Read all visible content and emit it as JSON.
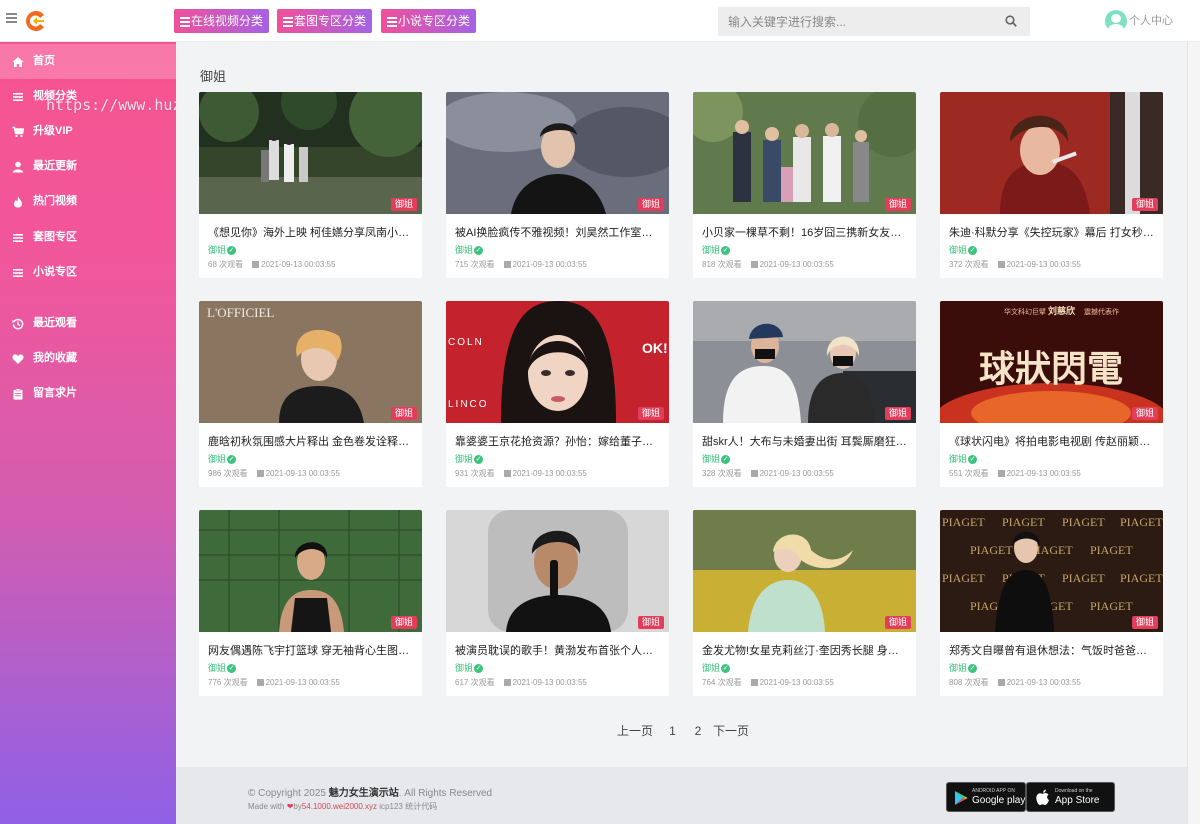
{
  "header": {
    "categories": [
      {
        "label": "在线视频分类"
      },
      {
        "label": "套图专区分类"
      },
      {
        "label": "小说专区分类"
      }
    ],
    "search_placeholder": "输入关键字进行搜索...",
    "user_center_label": "个人中心"
  },
  "sidebar": {
    "items": [
      {
        "label": "首页",
        "icon": "home-icon",
        "active": true
      },
      {
        "label": "视频分类",
        "icon": "list-icon"
      },
      {
        "label": "升级VIP",
        "icon": "cart-icon"
      },
      {
        "label": "最近更新",
        "icon": "user-icon"
      },
      {
        "label": "热门视频",
        "icon": "fire-icon"
      },
      {
        "label": "套图专区",
        "icon": "list-icon"
      },
      {
        "label": "小说专区",
        "icon": "list-icon"
      },
      {
        "label": "最近观看",
        "icon": "history-icon"
      },
      {
        "label": "我的收藏",
        "icon": "heart-icon"
      },
      {
        "label": "留言求片",
        "icon": "clipboard-icon"
      }
    ]
  },
  "watermark": "https://www.huzhan.com/ishop15931",
  "main": {
    "section_title": "御姐",
    "cards": [
      {
        "title": "《想见你》海外上映 柯佳嬿分享凤南小队登…",
        "category": "御姐",
        "badge": "御姐",
        "views": "68 次观看",
        "date": "2021-09-13 00:03:55"
      },
      {
        "title": "被AI换脸疯传不雅视频！刘昊然工作室报警…",
        "category": "御姐",
        "badge": "御姐",
        "views": "715 次观看",
        "date": "2021-09-13 00:03:55"
      },
      {
        "title": "小贝家一棵草不剩！16岁囧三携新女友现身…",
        "category": "御姐",
        "badge": "御姐",
        "views": "818 次观看",
        "date": "2021-09-13 00:03:55"
      },
      {
        "title": "朱迪·科默分享《失控玩家》幕后 打女秒变…",
        "category": "御姐",
        "badge": "御姐",
        "views": "372 次观看",
        "date": "2021-09-13 00:03:55"
      },
      {
        "title": "鹿晗初秋氛围感大片释出 金色卷发诠释双重…",
        "category": "御姐",
        "badge": "御姐",
        "views": "986 次观看",
        "date": "2021-09-13 00:03:55"
      },
      {
        "title": "靠婆婆王京花抢资源？孙怡：嫁给董子健只…",
        "category": "御姐",
        "badge": "御姐",
        "views": "931 次观看",
        "date": "2021-09-13 00:03:55"
      },
      {
        "title": "甜skr人！大布与未婚妻出街 耳鬓厮磨狂秀…",
        "category": "御姐",
        "badge": "御姐",
        "views": "328 次观看",
        "date": "2021-09-13 00:03:55"
      },
      {
        "title": "《球状闪电》将拍电影电视剧 传赵丽颖热巴…",
        "category": "御姐",
        "badge": "御姐",
        "views": "551 次观看",
        "date": "2021-09-13 00:03:55"
      },
      {
        "title": "网友偶遇陈飞宇打篮球 穿无袖背心生图状态…",
        "category": "御姐",
        "badge": "御姐",
        "views": "776 次观看",
        "date": "2021-09-13 00:03:55"
      },
      {
        "title": "被演员耽误的歌手！黄渤发布首张个人音乐…",
        "category": "御姐",
        "badge": "御姐",
        "views": "617 次观看",
        "date": "2021-09-13 00:03:55"
      },
      {
        "title": "金发尤物!女星克莉丝汀·奎因秀长腿 身材高…",
        "category": "御姐",
        "badge": "御姐",
        "views": "764 次观看",
        "date": "2021-09-13 00:03:55"
      },
      {
        "title": "郑秀文自曝曾有退休想法：气饭时爸爸都会…",
        "category": "御姐",
        "badge": "御姐",
        "views": "808 次观看",
        "date": "2021-09-13 00:03:55"
      }
    ],
    "thumb_texts": {
      "magazine": "L'OFFICIEL",
      "colno": "COLN",
      "linco": "LINCO",
      "ok": "OK!",
      "poster_top": "华文科幻巨擘",
      "poster_name": "刘慈欣",
      "poster_sub": "震撼代表作",
      "poster_title": "球狀閃電",
      "piaget": "PIAGET"
    }
  },
  "pagination": {
    "prev": "上一页",
    "pages": [
      "1",
      "2"
    ],
    "current": "1",
    "next": "下一页"
  },
  "footer": {
    "copyright_prefix": "© Copyright 2025",
    "site_name": "魅力女生演示站",
    "copyright_suffix": ". All Rights Reserved",
    "made_with": "Made with",
    "by_text": "by",
    "link_text": "54.1000.wei2000.xyz",
    "icp": "icp123",
    "stats": "统计代码",
    "google_play_small": "ANDROID APP ON",
    "google_play": "Google play",
    "app_store_small": "Download on the",
    "app_store": "App Store"
  },
  "colors": {
    "accent": "#f24a7b",
    "badge": "#e23d5b",
    "verified": "#3cc47e"
  }
}
